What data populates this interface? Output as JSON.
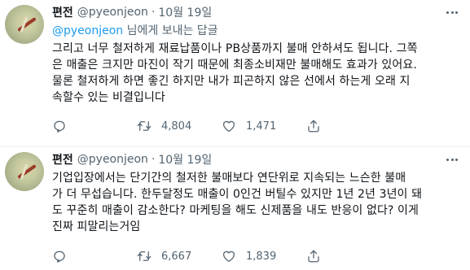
{
  "tweets": [
    {
      "name": "편전",
      "handle": "@pyeonjeon",
      "date": "10월 19일",
      "reply_to_prefix": "",
      "reply_to_user": "@pyeonjeon",
      "reply_to_suffix": " 님에게 보내는 답글",
      "lines": [
        "그리고 너무 철저하게 재료납품이나 PB상품까지 불매 안하셔도 됩니다. 그쪽",
        "은 매출은 크지만 마진이 작기 때문에 최종소비재만 불매해도 효과가 있어요.",
        "물론 철저하게 하면 좋긴 하지만 내가 피곤하지 않은 선에서 하는게 오래 지",
        "속할수 있는 비결입니다"
      ],
      "replies": "",
      "retweets": "4,804",
      "likes": "1,471"
    },
    {
      "name": "편전",
      "handle": "@pyeonjeon",
      "date": "10월 19일",
      "lines": [
        "기업입장에서는 단기간의 철저한 불매보다 연단위로 지속되는 느슨한 불매",
        "가 더 무섭습니다. 한두달정도 매출이 0인건 버틸수 있지만 1년 2년 3년이 돼",
        "도 꾸준히 매출이 감소한다? 마케팅을 해도 신제품을 내도 반응이 없다? 이게",
        "진짜 피말리는거임"
      ],
      "replies": "",
      "retweets": "6,667",
      "likes": "1,839"
    }
  ],
  "icons": {
    "reply": "reply-icon",
    "retweet": "retweet-icon",
    "like": "like-icon",
    "share": "share-icon",
    "more": "more-icon"
  }
}
